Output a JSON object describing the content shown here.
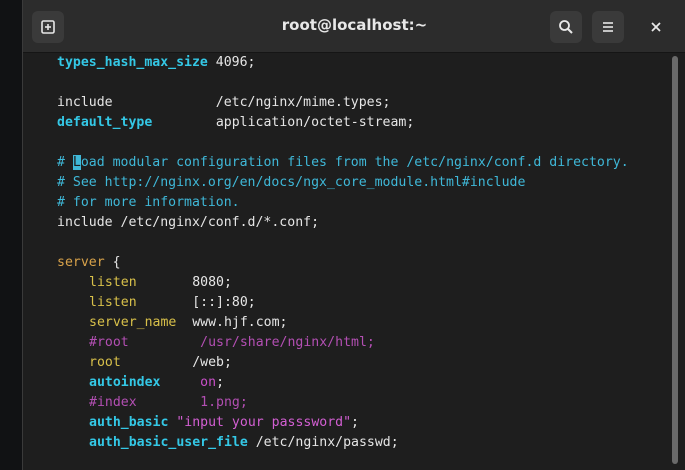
{
  "window": {
    "title": "root@localhost:~",
    "buttons": {
      "new_tab_icon": "new-tab-icon",
      "search_icon": "search-icon",
      "menu_icon": "hamburger-menu-icon",
      "close_icon": "close-icon"
    }
  },
  "terminal": {
    "l1": {
      "key": "types_hash_max_size",
      "rest": " 4096;"
    },
    "l3": {
      "key": "include",
      "pad": "             ",
      "value": "/etc/nginx/mime.types;"
    },
    "l4": {
      "key": "default_type",
      "pad": "        ",
      "value": "application/octet-stream;"
    },
    "l6": {
      "pre": "# ",
      "cursor_char": "L",
      "post": "oad modular configuration files from the /etc/nginx/conf.d directory."
    },
    "l7": "# See http://nginx.org/en/docs/ngx_core_module.html#include",
    "l8": "# for more information.",
    "l9": {
      "key": "include",
      "rest": " /etc/nginx/conf.d/*.conf;"
    },
    "l11": {
      "key": "server",
      "rest": " {"
    },
    "l12": {
      "key": "listen",
      "rest": "       8080;"
    },
    "l13": {
      "key": "listen",
      "rest": "       [::]:80;"
    },
    "l14": {
      "key": "server_name",
      "rest": "  www.hjf.com;"
    },
    "l15": "#root         /usr/share/nginx/html;",
    "l16": {
      "key": "root",
      "rest": "         /web;"
    },
    "l17": {
      "key": "autoindex",
      "pad": "     ",
      "value": "on",
      "semi": ";"
    },
    "l18": "#index        1.png;",
    "l19": {
      "key": "auth_basic",
      "space": " ",
      "value": "\"input your passsword\"",
      "semi": ";"
    },
    "l20": {
      "key": "auth_basic_user_file",
      "rest": " /etc/nginx/passwd;"
    }
  },
  "colors": {
    "keyword": "#34c8e6",
    "comment": "#3fb8d8",
    "value_purple": "#c94fc9",
    "background": "#1e1e1e"
  }
}
